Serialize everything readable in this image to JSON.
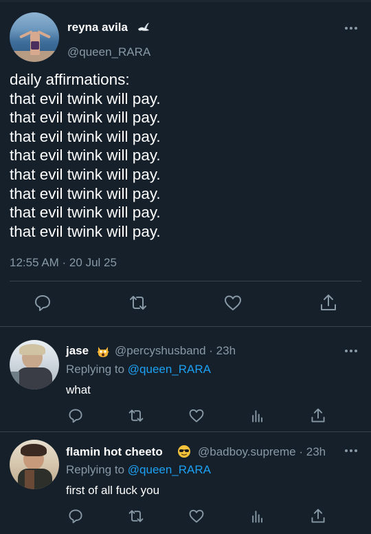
{
  "main_tweet": {
    "display_name": "reyna avila",
    "name_emoji": "dove-icon",
    "handle": "@queen_RARA",
    "lines": [
      "daily affirmations:",
      "that evil twink will pay.",
      "that evil twink will pay.",
      "that evil twink will pay.",
      "that evil twink will pay.",
      "that evil twink will pay.",
      "that evil twink will pay.",
      "that evil twink will pay.",
      "that evil twink will pay."
    ],
    "timestamp": "12:55 AM · 20 Jul 25",
    "actions": [
      "reply-icon",
      "retweet-icon",
      "like-icon",
      "share-icon"
    ]
  },
  "replies": [
    {
      "display_name": "jase",
      "name_emoji": "screaming-cat-icon",
      "handle": "@percyshusband",
      "time": "· 23h",
      "replying_prefix": "Replying to ",
      "replying_to": "@queen_RARA",
      "text": "what"
    },
    {
      "display_name": "flamin hot cheeto",
      "name_emoji": "sunglasses-face-icon",
      "handle": "@badboy.supreme",
      "time": "· 23h",
      "replying_prefix": "Replying to ",
      "replying_to": "@queen_RARA",
      "text": "first of all fuck you"
    }
  ],
  "colors": {
    "background": "#15202b",
    "secondary_text": "#8899a6",
    "link": "#1da1f2",
    "divider": "#38444d"
  }
}
